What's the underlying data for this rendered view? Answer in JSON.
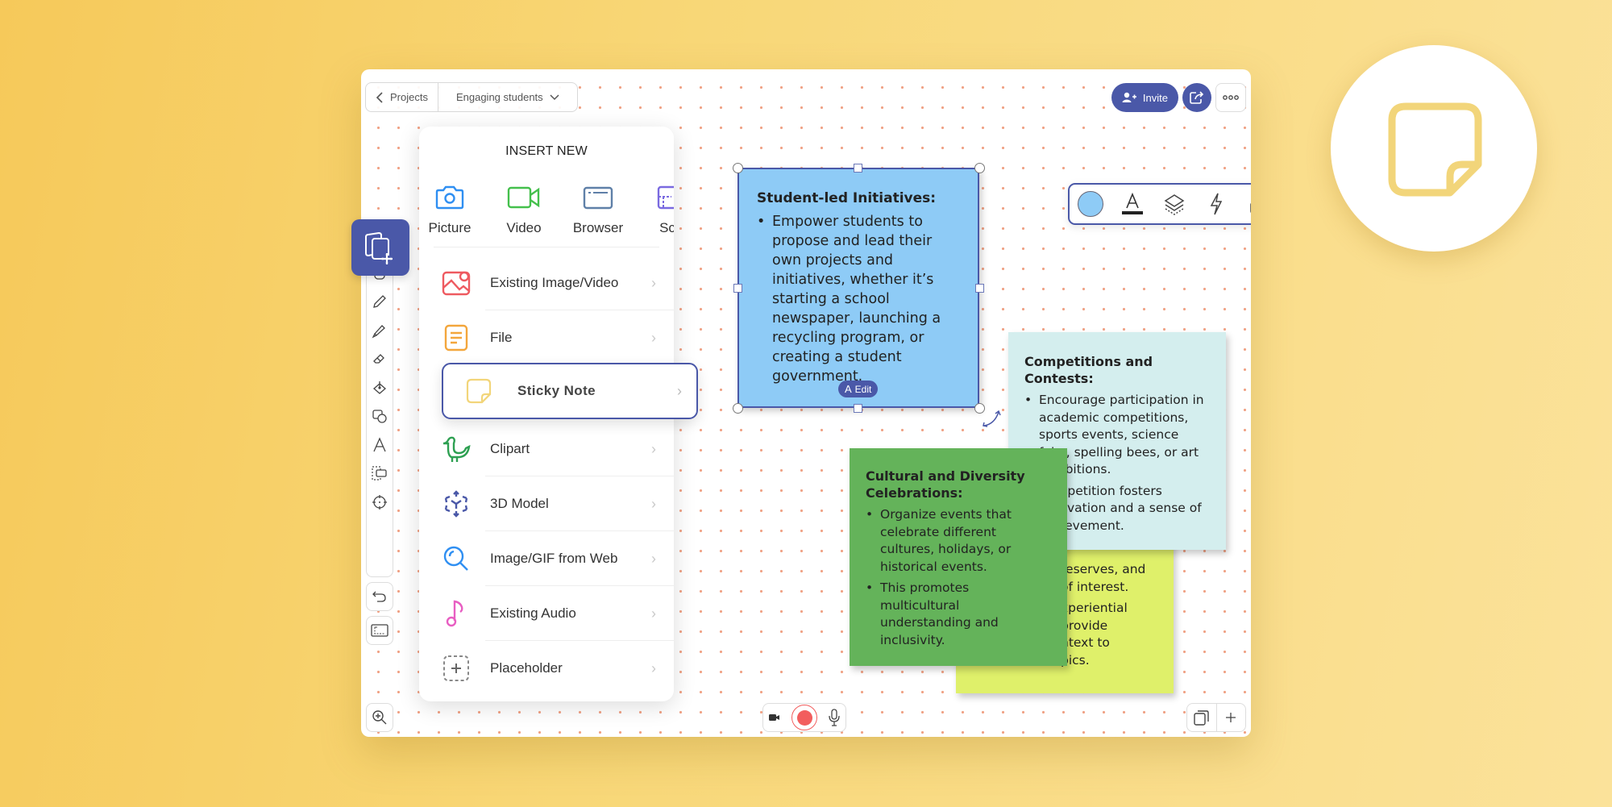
{
  "topbar": {
    "back_label": "Projects",
    "board_name": "Engaging students",
    "invite_label": "Invite"
  },
  "insert_panel": {
    "title": "INSERT NEW",
    "quick_items": [
      {
        "label": "Picture",
        "icon": "camera-icon",
        "color": "#2f8ff2"
      },
      {
        "label": "Video",
        "icon": "video-icon",
        "color": "#44c04c"
      },
      {
        "label": "Browser",
        "icon": "browser-icon",
        "color": "#5f80a8"
      },
      {
        "label": "Sc",
        "icon": "screen-icon",
        "color": "#7a6ae0"
      }
    ],
    "items": [
      {
        "label": "Existing Image/Video",
        "icon": "image-icon",
        "color": "#ee5a60"
      },
      {
        "label": "File",
        "icon": "file-icon",
        "color": "#f3a63c"
      },
      {
        "label": "Sticky Note",
        "icon": "sticky-note-icon",
        "color": "#f2d57a"
      },
      {
        "label": "Clipart",
        "icon": "bird-icon",
        "color": "#2ea052"
      },
      {
        "label": "3D Model",
        "icon": "cube-icon",
        "color": "#4a58a8"
      },
      {
        "label": "Image/GIF from Web",
        "icon": "web-search-icon",
        "color": "#2f8ff2"
      },
      {
        "label": "Existing Audio",
        "icon": "music-note-icon",
        "color": "#e85ec2"
      },
      {
        "label": "Placeholder",
        "icon": "placeholder-icon",
        "color": "#888888"
      }
    ],
    "highlighted": "Sticky Note"
  },
  "float_toolbar": {
    "fill_color": "#8ecbf6",
    "delete_color": "#f06060"
  },
  "notes": {
    "blue": {
      "title": "Student-led Initiatives:",
      "bullets": [
        "Empower students to propose and lead their own projects and initiatives, whether it’s starting a school newspaper, launching a recycling program, or creating a student government."
      ],
      "edit_label": "Edit",
      "color": "#8ecbf6"
    },
    "teal": {
      "title": "Competitions and Contests:",
      "bullets": [
        "Encourage participation in academic competitions, sports events, science fairs, spelling bees, or art exhibitions.",
        "Competition fosters motivation and a sense of achievement."
      ],
      "color": "#d4eeee"
    },
    "green": {
      "title": "Cultural and Diversity Celebrations:",
      "bullets": [
        "Organize events that celebrate different cultures, holidays, or historical events.",
        "This promotes multicultural understanding and inclusivity."
      ],
      "color": "#64b35a"
    },
    "yellow": {
      "lines_a": [
        "reserves, and",
        "of interest."
      ],
      "lines_b": [
        "xperiential",
        "provide",
        "ntext to",
        "pics."
      ],
      "color": "#dff06a"
    }
  },
  "colors": {
    "accent": "#4a58a8",
    "record": "#f25d5d",
    "background": "#f8d777"
  }
}
